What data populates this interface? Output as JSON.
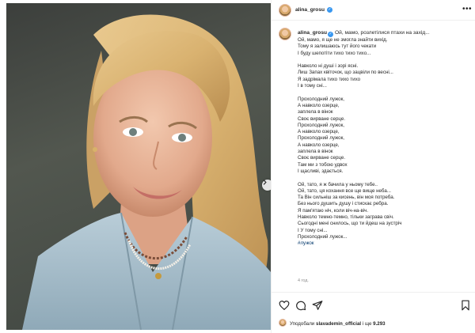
{
  "post": {
    "username": "alina_grosu",
    "caption_title": "Ой, мамо, розлетілися птахи на захід...",
    "lines": [
      "Ой, мамо, я ще не змогла знайти вихід.",
      "Тому я залишаюсь тут його чекати",
      "І буду шепотіти тихо тихо тихо...",
      "",
      "Навколо ні душі і зорі ясні.",
      "Лиш Запах квіточок, що зацвіли по весні...",
      "Я задрімала тихо тихо тихо",
      "І в тому сні...",
      "",
      "Прохолодний лужок,",
      "А навколо озерце,",
      "заплела в вінок",
      "Своє вирване серце.",
      "Прохолодний лужок,",
      "А навколо озерце,",
      "Прохолодний лужок,",
      "А навколо озерце,",
      "заплела в вінок",
      "Своє вирване серце.",
      "Там ми з тобою удвох",
      "І щасливі, здається.",
      "",
      "Ой, тато, я ж бачила у ньому тебе..",
      "Ой, тато, ця кохання все ще вище неба...",
      "Та Він сильніш за кисень, він моя потреба.",
      "Без нього душить душу і стискає ребра.",
      "Я пам'ятаю ніч, коли віч-на-віч.",
      "Навколо темно-темно, тільки заграва свіч.",
      "Сьогодні мені снилось, що ти йдеш на зустріч",
      "І У тому сні...",
      "Прохолодний лужок..."
    ],
    "hashtag": "#лужок",
    "time_ago": "4 год.",
    "liked_by_prefix": "Уподобали",
    "liked_by_user": "slavademin_official",
    "liked_by_suffix": "і ще",
    "likes_count": "9.293"
  },
  "icons": {
    "more": "more-options-icon",
    "verified": "verified-badge-icon",
    "next": "chevron-right-icon",
    "like": "heart-icon",
    "comment": "comment-icon",
    "share": "paper-plane-icon",
    "save": "bookmark-icon"
  },
  "colors": {
    "verified_blue": "#3897f0",
    "hashtag": "#00376b",
    "muted_text": "#8e8e8e"
  }
}
